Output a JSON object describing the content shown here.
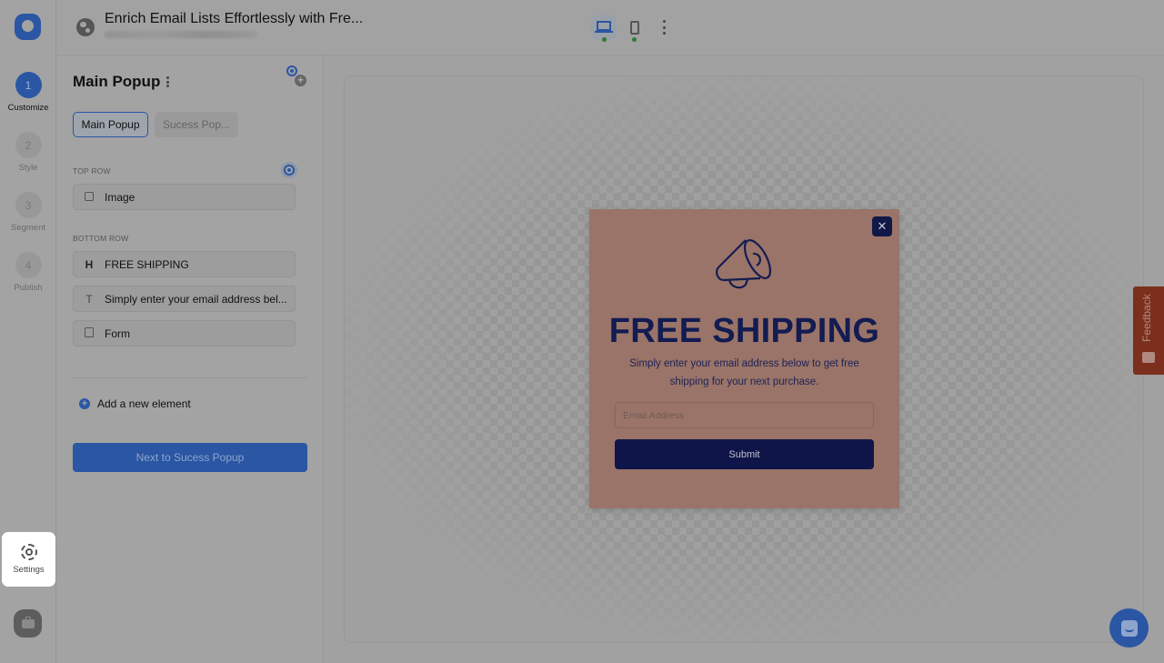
{
  "header": {
    "title": "Enrich Email Lists Effortlessly with Fre...",
    "url_blurred": true,
    "devices": [
      {
        "name": "desktop",
        "active": true,
        "status": "green"
      },
      {
        "name": "mobile",
        "active": false,
        "status": "green"
      }
    ]
  },
  "steps": [
    {
      "number": "1",
      "label": "Customize",
      "active": true
    },
    {
      "number": "2",
      "label": "Style",
      "active": false
    },
    {
      "number": "3",
      "label": "Segment",
      "active": false
    },
    {
      "number": "4",
      "label": "Publish",
      "active": false
    }
  ],
  "settings": {
    "label": "Settings"
  },
  "panel": {
    "title": "Main Popup",
    "tabs": [
      {
        "label": "Main Popup",
        "active": true
      },
      {
        "label": "Sucess Pop...",
        "active": false
      }
    ],
    "top_row": {
      "label": "TOP ROW",
      "elements": [
        {
          "icon": "image-icon",
          "label": "Image"
        }
      ]
    },
    "bottom_row": {
      "label": "BOTTOM ROW",
      "elements": [
        {
          "icon": "heading-icon",
          "glyph": "H",
          "label": "FREE SHIPPING"
        },
        {
          "icon": "text-icon",
          "glyph": "T",
          "label": "Simply enter your email address bel..."
        },
        {
          "icon": "form-icon",
          "label": "Form"
        }
      ]
    },
    "add_element": "Add a new element",
    "next_button": "Next to Sucess Popup"
  },
  "popup": {
    "close_glyph": "✕",
    "heading": "FREE SHIPPING",
    "text": "Simply enter your email address below to get free shipping for your next purchase.",
    "email_placeholder": "Email Address",
    "submit_label": "Submit",
    "colors": {
      "background": "#d39c8b",
      "primary": "#131c52"
    }
  },
  "feedback": {
    "label": "Feedback"
  },
  "colors": {
    "accent": "#3a74e0",
    "feedback": "#b3402a"
  }
}
